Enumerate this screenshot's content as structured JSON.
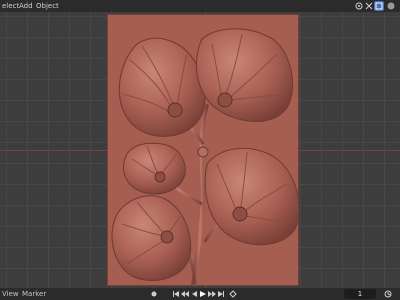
{
  "header": {
    "menu": [
      "elect",
      "Add",
      "Object"
    ]
  },
  "footer": {
    "menu": [
      "View",
      "Marker"
    ],
    "current_frame": "1"
  },
  "icons": {
    "header_right": [
      "viewport-gizmo-icon",
      "close-icon",
      "overlay-icon",
      "shading-dropdown-icon"
    ],
    "playback": [
      "record-icon",
      "jump-start-icon",
      "prev-keyframe-icon",
      "play-reverse-icon",
      "play-icon",
      "next-keyframe-icon",
      "jump-end-icon"
    ],
    "clock": "clock-icon"
  },
  "colors": {
    "relief": "#b0675a",
    "relief_dark": "#6e3a32",
    "viewport_bg": "#3d3d3d",
    "header_bg": "#2b2b2b"
  }
}
